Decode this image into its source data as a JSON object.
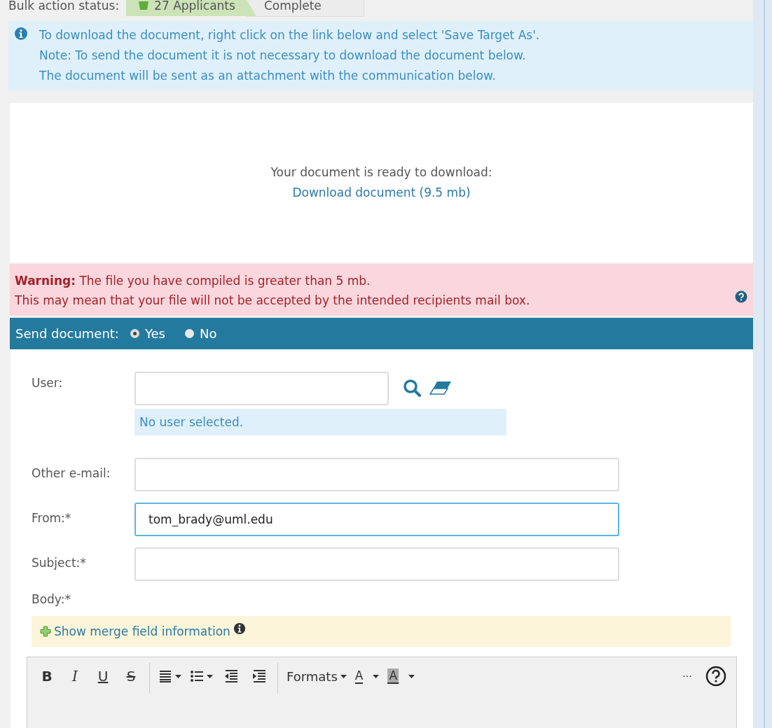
{
  "bulk_status": {
    "label": "Bulk action status:",
    "steps": [
      {
        "text": "27 Applicants",
        "done": true
      },
      {
        "text": "Complete",
        "done": false
      }
    ]
  },
  "info": {
    "lines": [
      "To download the document, right click on the link below and select 'Save Target As'.",
      "Note: To send the document it is not necessary to download the document below.",
      "The document will be sent as an attachment with the communication below."
    ]
  },
  "download": {
    "text": "Your document is ready to download:",
    "link": "Download document (9.5 mb)"
  },
  "warning": {
    "lines": [
      "**Warning:** The file you have compiled is greater than 5 mb.",
      "This may mean that your file will not be accepted by the intended recipients mail box."
    ]
  },
  "send_document": {
    "label": "Send document:",
    "options": [
      {
        "label": "Yes",
        "selected": true
      },
      {
        "label": "No",
        "selected": false
      }
    ]
  },
  "form": {
    "user": {
      "label": "User:",
      "note": "No user selected."
    },
    "fields": [
      {
        "label": "Other e-mail:",
        "focused": false
      },
      {
        "label": "From:*",
        "value": "tom_brady@uml.edu",
        "focused": true
      },
      {
        "label": "Subject:*",
        "focused": false
      }
    ],
    "body_label": "Body:*",
    "merge_link": "Show merge field information"
  },
  "toolbar": [
    {
      "kind": "bold",
      "text": "B"
    },
    {
      "kind": "italic",
      "text": "I"
    },
    {
      "kind": "underline",
      "text": "U"
    },
    {
      "kind": "strike",
      "text": "S"
    },
    {
      "kind": "sep"
    },
    {
      "kind": "align"
    },
    {
      "kind": "list"
    },
    {
      "kind": "outdent"
    },
    {
      "kind": "indent"
    },
    {
      "kind": "sep"
    },
    {
      "kind": "menu",
      "text": "Formats"
    },
    {
      "kind": "textcolor",
      "text": "A"
    },
    {
      "kind": "highlight",
      "text": "A"
    },
    {
      "kind": "spacer"
    },
    {
      "kind": "more",
      "text": "···"
    },
    {
      "kind": "help"
    }
  ]
}
